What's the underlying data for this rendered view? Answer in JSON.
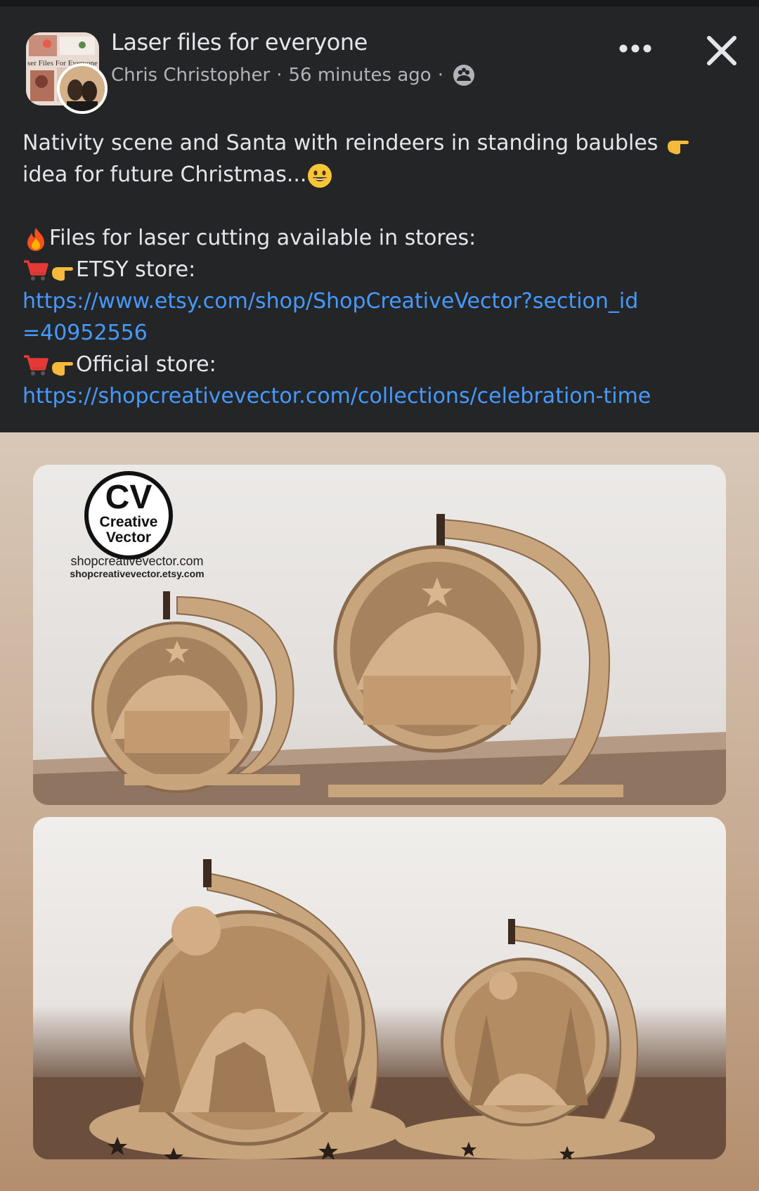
{
  "header": {
    "group_name": "Laser files for everyone",
    "author": "Chris Christopher",
    "separator": "·",
    "time": "56 minutes ago",
    "group_thumbnail_text": "ser Files For Everyone",
    "privacy_icon": "group-privacy-icon",
    "more_icon": "more-options-icon",
    "close_icon": "close-icon"
  },
  "post": {
    "line1_a": "Nativity scene and Santa with reindeers in standing baubles ",
    "line1_b": " idea for future Christmas...",
    "line3": "Files for laser cutting available in stores:",
    "etsy_label": "ETSY store:",
    "etsy_url": "https://www.etsy.com/shop/ShopCreativeVector?section_id=40952556",
    "official_label": "Official store:",
    "official_url": "https://shopcreativevector.com/collections/celebration-time"
  },
  "photo": {
    "logo_letters": "CV",
    "logo_line1": "Creative",
    "logo_line2": "Vector",
    "url1": "shopcreativevector.com",
    "url2": "shopcreativevector.etsy.com"
  },
  "colors": {
    "background": "#242526",
    "link": "#4599ff",
    "text": "#e4e6eb",
    "meta": "#b0b3b8"
  }
}
